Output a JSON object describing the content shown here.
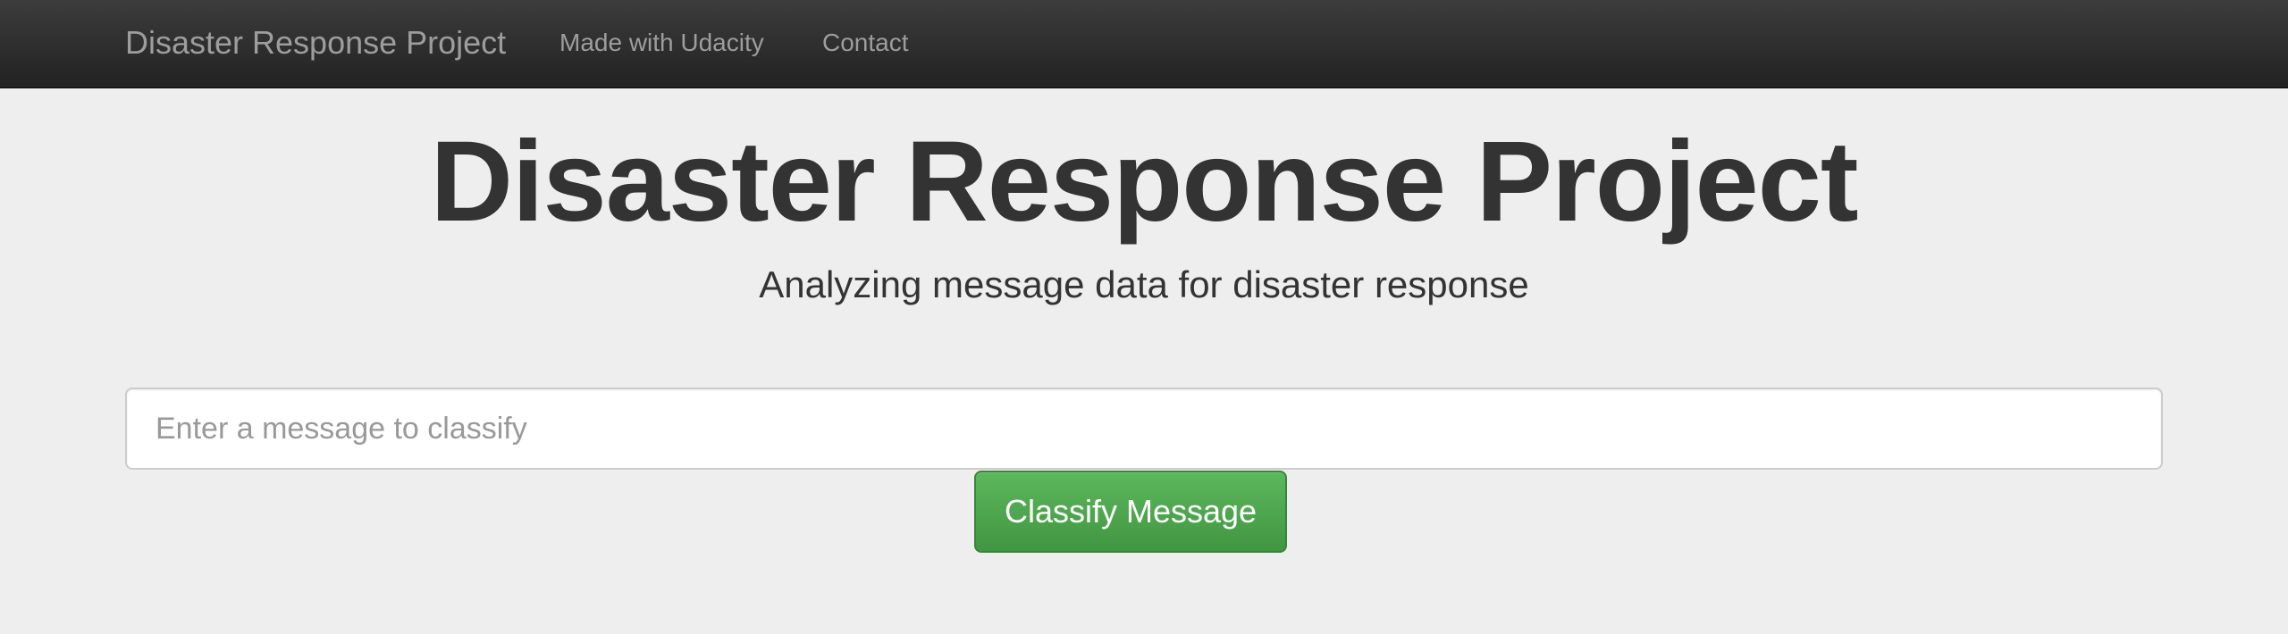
{
  "navbar": {
    "brand": "Disaster Response Project",
    "links": [
      {
        "label": "Made with Udacity"
      },
      {
        "label": "Contact"
      }
    ]
  },
  "jumbotron": {
    "title": "Disaster Response Project",
    "subtitle": "Analyzing message data for disaster response"
  },
  "form": {
    "placeholder": "Enter a message to classify",
    "value": "",
    "button_label": "Classify Message"
  },
  "colors": {
    "navbar_bg": "#222222",
    "page_bg": "#eeeeee",
    "button_green": "#5cb85c",
    "title_text": "#333333"
  }
}
